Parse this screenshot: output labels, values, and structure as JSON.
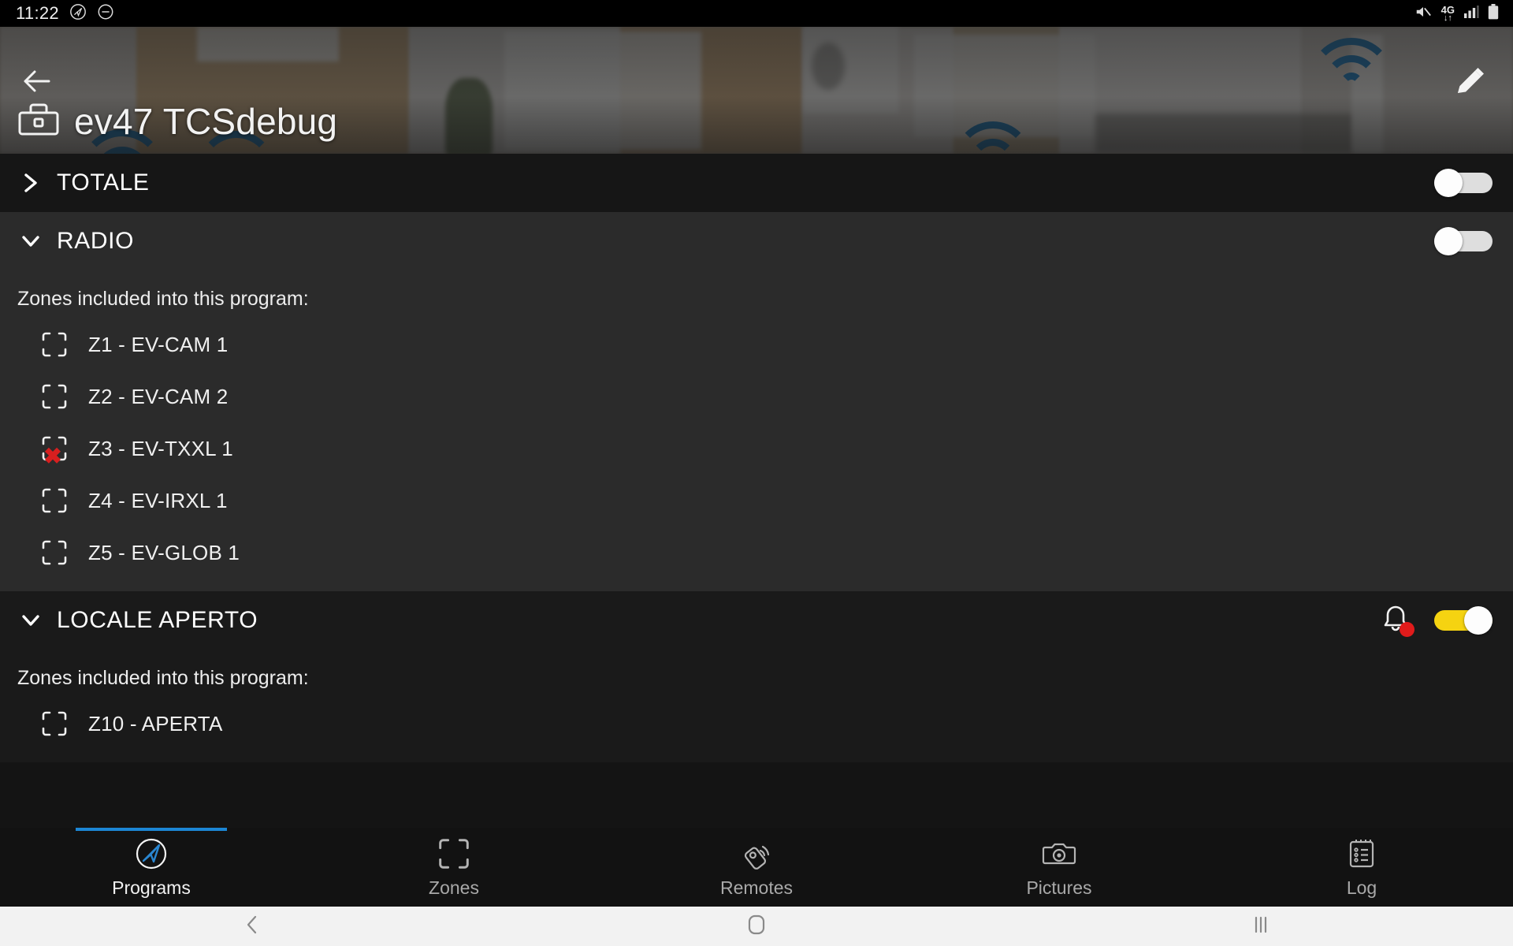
{
  "status_bar": {
    "time": "11:22",
    "left_icons": [
      "navigation-app-icon",
      "do-not-disturb-icon"
    ],
    "network_label": "4G",
    "network_arrows": "↓↑",
    "right_icons": [
      "mute-icon",
      "signal-bars-icon",
      "battery-icon"
    ]
  },
  "header": {
    "title": "ev47 TCSdebug",
    "back_icon": "back-arrow-icon",
    "system_icon": "toolbox-icon",
    "edit_icon": "pencil-icon"
  },
  "programs": [
    {
      "name": "TOTALE",
      "expanded": false,
      "chevron": "chevron-right-icon",
      "toggle_on": false,
      "has_alarm_bell": false,
      "zones_label": "",
      "zones": []
    },
    {
      "name": "RADIO",
      "expanded": true,
      "chevron": "chevron-down-icon",
      "toggle_on": false,
      "has_alarm_bell": false,
      "zones_label": "Zones included into this program:",
      "zones": [
        {
          "label": "Z1 - EV-CAM 1",
          "fault": false
        },
        {
          "label": "Z2 - EV-CAM 2",
          "fault": false
        },
        {
          "label": "Z3 - EV-TXXL 1",
          "fault": true
        },
        {
          "label": "Z4 - EV-IRXL 1",
          "fault": false
        },
        {
          "label": "Z5 - EV-GLOB 1",
          "fault": false
        }
      ]
    },
    {
      "name": "LOCALE APERTO",
      "expanded": true,
      "chevron": "chevron-down-icon",
      "toggle_on": true,
      "has_alarm_bell": true,
      "zones_label": "Zones included into this program:",
      "zones": [
        {
          "label": "Z10 - APERTA",
          "fault": false
        }
      ]
    }
  ],
  "tabs": [
    {
      "label": "Programs",
      "icon": "compass-logo-icon",
      "active": true
    },
    {
      "label": "Zones",
      "icon": "scan-frame-icon",
      "active": false
    },
    {
      "label": "Remotes",
      "icon": "remote-signal-icon",
      "active": false
    },
    {
      "label": "Pictures",
      "icon": "camera-icon",
      "active": false
    },
    {
      "label": "Log",
      "icon": "clipboard-list-icon",
      "active": false
    }
  ],
  "android_nav": [
    {
      "name": "back-nav-button",
      "icon": "chevron-left-icon"
    },
    {
      "name": "home-nav-button",
      "icon": "home-square-icon"
    },
    {
      "name": "recents-nav-button",
      "icon": "recents-bars-icon"
    }
  ],
  "colors": {
    "accent_blue": "#1c86d4",
    "toggle_on": "#f5d311",
    "alert_red": "#e01b1b",
    "fault_red": "#d81f1f"
  }
}
